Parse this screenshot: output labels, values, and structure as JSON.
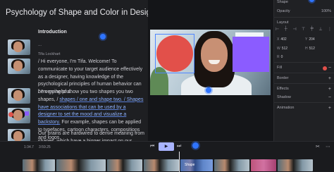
{
  "transcript": {
    "title": "Psychology of Shape and Color in Design",
    "section": "Introduction",
    "ellipsis": "...",
    "speaker": "Tifa Lockhart",
    "para1": "/ Hi everyone, I'm Tifa. Welcome! To communicate to your target audience effectively as a designer, having knowledge of the psychological principles of human behavior can be very helpful.",
    "para2_a": "/ I'm going to show you two shapes you two shapes, / ",
    "para2_hl": "shapes / one and shape two. / Shapes have associations that can be used by a designer to set the mood and visualize a backstory.",
    "para2_b": " For example, shapes can be applied to typefaces, cartoon characters, compositions and logos.",
    "para3": "Our brains are hardwired to derive meaning from shapes, which have a bigger impact on our"
  },
  "inspector": {
    "top_label": "Shape",
    "opacity_label": "Opacity",
    "opacity_value": "100%",
    "layout_label": "Layout",
    "x_label": "X",
    "x_value": "402",
    "y_label": "Y",
    "y_value": "204",
    "w_label": "W",
    "w_value": "512",
    "h_label": "H",
    "h_value": "512",
    "r_label": "R",
    "r_value": "0",
    "fill_label": "Fill",
    "border_label": "Border",
    "effects_label": "Effects",
    "shadow_label": "Shadow",
    "animation_label": "Animation"
  },
  "timeline": {
    "time_current": "1:34.7",
    "time_total": "3:59.25",
    "play_icon": "▶",
    "clip_label": "Shape"
  },
  "colors": {
    "accent_blue": "#2f74ff",
    "shape_red": "#e2504a",
    "shape_purple": "#8b5cff",
    "play_button": "#a9b4ff"
  }
}
